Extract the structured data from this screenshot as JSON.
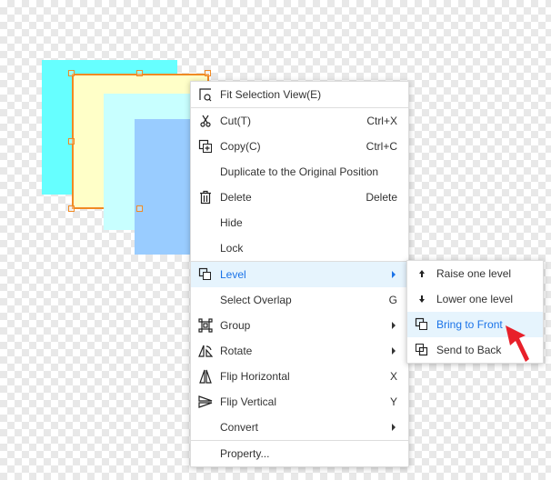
{
  "canvas": {
    "shape_colors": [
      "#66ffff",
      "#ffffc8",
      "#c8ffff",
      "#99ccff"
    ],
    "selection_color": "#f08a24"
  },
  "context_menu": {
    "items": [
      {
        "icon": "fit-view-icon",
        "label": "Fit Selection View(E)",
        "shortcut": ""
      },
      {
        "icon": "scissors-icon",
        "label": "Cut(T)",
        "shortcut": "Ctrl+X"
      },
      {
        "icon": "copy-icon",
        "label": "Copy(C)",
        "shortcut": "Ctrl+C"
      },
      {
        "icon": "",
        "label": "Duplicate to the Original Position",
        "shortcut": ""
      },
      {
        "icon": "trash-icon",
        "label": "Delete",
        "shortcut": "Delete"
      },
      {
        "icon": "",
        "label": "Hide",
        "shortcut": ""
      },
      {
        "icon": "",
        "label": "Lock",
        "shortcut": ""
      },
      {
        "icon": "layers-icon",
        "label": "Level",
        "shortcut": "",
        "submenu": true,
        "active": true
      },
      {
        "icon": "",
        "label": "Select Overlap",
        "shortcut": "G"
      },
      {
        "icon": "group-icon",
        "label": "Group",
        "shortcut": "",
        "submenu": true
      },
      {
        "icon": "rotate-icon",
        "label": "Rotate",
        "shortcut": "",
        "submenu": true
      },
      {
        "icon": "flip-horizontal-icon",
        "label": "Flip Horizontal",
        "shortcut": "X"
      },
      {
        "icon": "flip-vertical-icon",
        "label": "Flip Vertical",
        "shortcut": "Y"
      },
      {
        "icon": "",
        "label": "Convert",
        "shortcut": "",
        "submenu": true
      },
      {
        "icon": "",
        "label": "Property...",
        "shortcut": ""
      }
    ]
  },
  "level_submenu": {
    "items": [
      {
        "icon": "arrow-up-icon",
        "label": "Raise one level"
      },
      {
        "icon": "arrow-down-icon",
        "label": "Lower one level"
      },
      {
        "icon": "bring-to-front-icon",
        "label": "Bring to Front",
        "active": true
      },
      {
        "icon": "send-to-back-icon",
        "label": "Send to Back"
      }
    ]
  },
  "accent_color": "#1a73e8",
  "pointer_color": "#e8202a"
}
